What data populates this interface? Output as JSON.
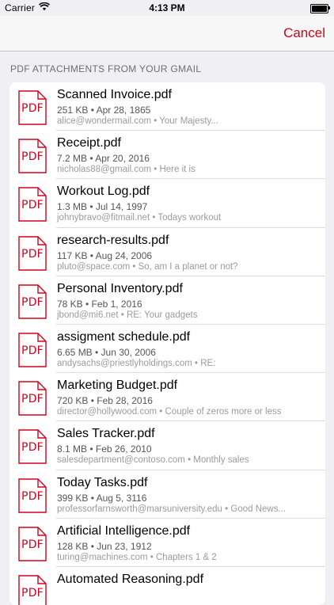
{
  "status_bar": {
    "carrier": "Carrier",
    "time": "4:13 PM",
    "wifi_icon": "wifi-icon",
    "battery_icon": "battery-icon",
    "battery_level": 1.0
  },
  "nav": {
    "cancel_label": "Cancel"
  },
  "section": {
    "header": "PDF ATTACHMENTS FROM YOUR GMAIL"
  },
  "icons": {
    "pdf_label": "PDF",
    "pdf_icon": "pdf-file-icon"
  },
  "colors": {
    "accent": "#d0021b",
    "background": "#efeff4"
  },
  "attachments": [
    {
      "name": "Scanned Invoice.pdf",
      "meta": "251 KB • Apr 28, 1865",
      "source": "alice@wondermail.com • Your Majesty..."
    },
    {
      "name": "Receipt.pdf",
      "meta": "7.2 MB • Apr 20, 2016",
      "source": "nicholas88@gmail.com • Here it is"
    },
    {
      "name": "Workout Log.pdf",
      "meta": "1.3 MB • Jul 14, 1997",
      "source": "johnybravo@fitmail.net • Todays workout"
    },
    {
      "name": "research-results.pdf",
      "meta": "117 KB • Aug 24, 2006",
      "source": "pluto@space.com • So, am I a planet or not?"
    },
    {
      "name": "Personal Inventory.pdf",
      "meta": "78 KB • Feb 1, 2016",
      "source": "jbond@mi6.net • RE: Your gadgets"
    },
    {
      "name": "assigment schedule.pdf",
      "meta": "6.65 MB • Jun 30, 2006",
      "source": "andysachs@priestlyholdings.com • RE:"
    },
    {
      "name": "Marketing Budget.pdf",
      "meta": "720 KB • Feb 28, 2016",
      "source": "director@hollywood.com • Couple of zeros more or less"
    },
    {
      "name": "Sales Tracker.pdf",
      "meta": "8.1 MB • Feb 26, 2010",
      "source": "salesdepartment@contoso.com • Monthly sales"
    },
    {
      "name": "Today Tasks.pdf",
      "meta": "399 KB • Aug 5, 3116",
      "source": "professorfarnsworth@marsuniversity.edu • Good News..."
    },
    {
      "name": "Artificial Intelligence.pdf",
      "meta": "128 KB • Jun 23, 1912",
      "source": "turing@machines.com • Chapters 1 & 2"
    },
    {
      "name": "Automated Reasoning.pdf",
      "meta": "",
      "source": ""
    }
  ]
}
